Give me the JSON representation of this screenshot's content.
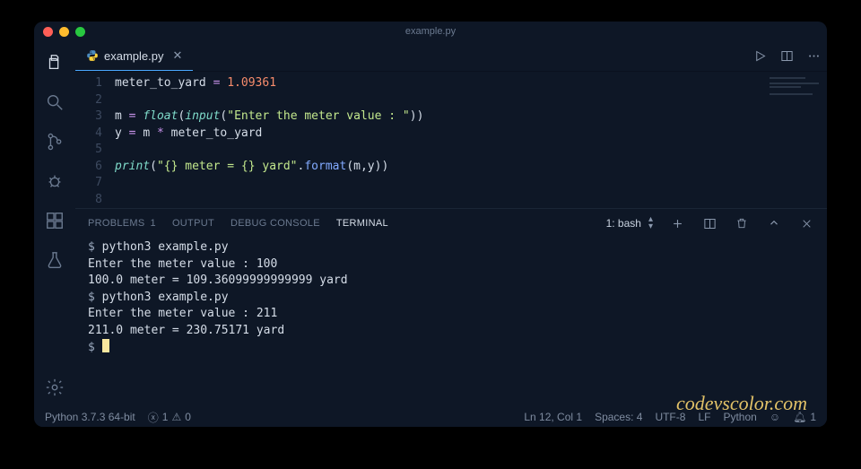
{
  "window": {
    "title": "example.py"
  },
  "tab": {
    "filename": "example.py",
    "icon": "python-icon"
  },
  "code": {
    "lines": [
      {
        "n": 1,
        "html": "<span class='tok-var'>meter_to_yard</span> <span class='tok-op'>=</span> <span class='tok-num'>1.09361</span>"
      },
      {
        "n": 2,
        "html": ""
      },
      {
        "n": 3,
        "html": "<span class='tok-var'>m</span> <span class='tok-op'>=</span> <span class='tok-builtin'>float</span>(<span class='tok-builtin'>input</span>(<span class='tok-str'>\"Enter the meter value : \"</span>))"
      },
      {
        "n": 4,
        "html": "<span class='tok-var'>y</span> <span class='tok-op'>=</span> <span class='tok-var'>m</span> <span class='tok-op'>*</span> <span class='tok-var'>meter_to_yard</span>"
      },
      {
        "n": 5,
        "html": ""
      },
      {
        "n": 6,
        "html": "<span class='tok-builtin'>print</span>(<span class='tok-str'>\"{} meter = {} yard\"</span>.<span class='tok-fn'>format</span>(<span class='tok-var'>m</span>,<span class='tok-var'>y</span>))"
      },
      {
        "n": 7,
        "html": ""
      },
      {
        "n": 8,
        "html": ""
      }
    ]
  },
  "panel": {
    "tabs": {
      "problems": "PROBLEMS",
      "problems_count": "1",
      "output": "OUTPUT",
      "debug": "DEBUG CONSOLE",
      "terminal": "TERMINAL"
    },
    "shell": "1: bash"
  },
  "terminal": [
    "$ python3 example.py",
    "Enter the meter value : 100",
    "100.0 meter = 109.36099999999999 yard",
    "$ python3 example.py",
    "Enter the meter value : 211",
    "211.0 meter = 230.75171 yard",
    "$ "
  ],
  "status": {
    "interpreter": "Python 3.7.3 64-bit",
    "errors": "1",
    "warnings": "0",
    "cursor": "Ln 12, Col 1",
    "spaces": "Spaces: 4",
    "encoding": "UTF-8",
    "eol": "LF",
    "lang": "Python",
    "bell_count": "1"
  },
  "watermark": "codevscolor.com"
}
